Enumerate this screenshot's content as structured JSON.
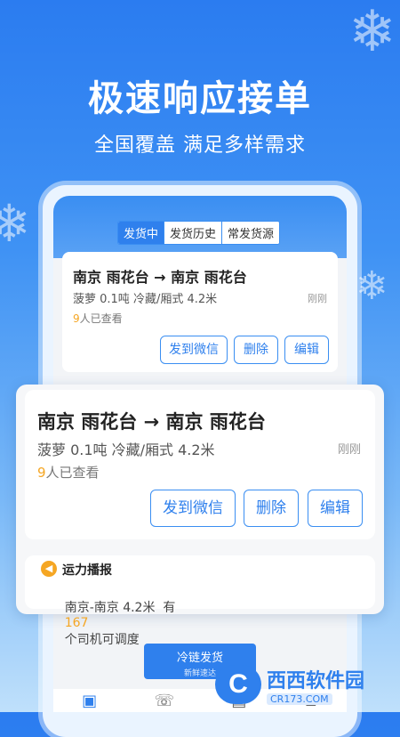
{
  "hero": {
    "headline": "极速响应接单",
    "subline": "全国覆盖 满足多样需求"
  },
  "tabs": [
    "发货中",
    "发货历史",
    "常发货源"
  ],
  "shipment": {
    "route": "南京 雨花台 → 南京 雨花台",
    "goods": "菠萝 0.1吨 冷藏/厢式 4.2米",
    "time": "刚刚",
    "viewed_count": "9",
    "viewed_suffix": "人已查看",
    "buttons": {
      "wechat": "发到微信",
      "delete": "删除",
      "edit": "编辑"
    }
  },
  "broadcast": {
    "title": "运力播报",
    "prefix": "南京-南京 4.2米  有",
    "count": "167",
    "suffix": "个司机可调度"
  },
  "cta": {
    "title": "冷链发货",
    "subtitle": "新鲜速达"
  },
  "watermark": {
    "title": "西西软件园",
    "url": "CR173.COM"
  },
  "icons": {
    "nav": [
      "box-icon",
      "phone-list-icon",
      "document-icon",
      "person-icon"
    ]
  }
}
